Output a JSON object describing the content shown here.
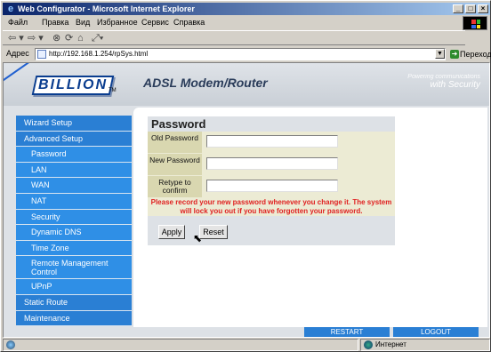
{
  "window": {
    "title": "Web Configurator - Microsoft Internet Explorer"
  },
  "menu": [
    "Файл",
    "Правка",
    "Вид",
    "Избранное",
    "Сервис",
    "Справка"
  ],
  "address": {
    "label": "Адрес",
    "url": "http://192.168.1.254/rpSys.html",
    "go_label": "Переход"
  },
  "header": {
    "logo": "BILLION",
    "trademark": "TM",
    "product": "ADSL Modem/Router",
    "tagline_top": "Powering communications",
    "tagline_bottom": "with Security"
  },
  "sidebar": [
    {
      "label": "Wizard Setup",
      "type": "main"
    },
    {
      "label": "Advanced Setup",
      "type": "main"
    },
    {
      "label": "Password",
      "type": "sub"
    },
    {
      "label": "LAN",
      "type": "sub"
    },
    {
      "label": "WAN",
      "type": "sub"
    },
    {
      "label": "NAT",
      "type": "sub"
    },
    {
      "label": "Security",
      "type": "sub"
    },
    {
      "label": "Dynamic DNS",
      "type": "sub"
    },
    {
      "label": "Time Zone",
      "type": "sub"
    },
    {
      "label": "Remote Management Control",
      "type": "sub"
    },
    {
      "label": "UPnP",
      "type": "sub"
    },
    {
      "label": "Static Route",
      "type": "main"
    },
    {
      "label": "Maintenance",
      "type": "main"
    }
  ],
  "form": {
    "title": "Password",
    "fields": [
      {
        "label": "Old Password",
        "value": ""
      },
      {
        "label": "New Password",
        "value": ""
      },
      {
        "label": "Retype to confirm",
        "value": ""
      }
    ],
    "warning": "Please record your new password whenever you change it. The system will lock you out if you have forgotten your password.",
    "apply_label": "Apply",
    "reset_label": "Reset"
  },
  "bottom": {
    "restart_label": "RESTART",
    "logout_label": "LOGOUT"
  },
  "status": {
    "text": "",
    "zone": "Интернет"
  },
  "colors": {
    "nav": "#2a7fd4",
    "nav_sub": "#2f8fe6",
    "warning": "#e02020",
    "title_bar": "#0a246a"
  }
}
